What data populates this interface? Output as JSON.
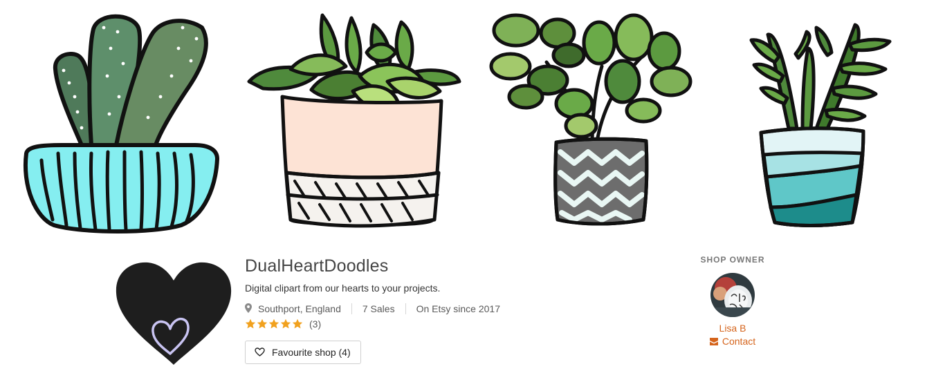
{
  "shop": {
    "name": "DualHeartDoodles",
    "tagline": "Digital clipart from our hearts to your projects.",
    "location": "Southport, England",
    "sales": "7 Sales",
    "since": "On Etsy since 2017",
    "rating": {
      "stars": 5,
      "max": 5,
      "count": "(3)"
    },
    "favourite_label": "Favourite shop (4)"
  },
  "owner": {
    "heading": "SHOP OWNER",
    "name": "Lisa B",
    "contact_label": "Contact"
  },
  "icons": {
    "location": "map-pin-icon",
    "star": "star-icon",
    "favourite": "heart-outline-icon",
    "contact": "envelope-icon",
    "logo": "heart-logo"
  },
  "colors": {
    "accent": "#d5641c",
    "star": "#f1a11e",
    "logo": "#1e1e1e",
    "logo_inner_heart": "#c9c4f2"
  }
}
